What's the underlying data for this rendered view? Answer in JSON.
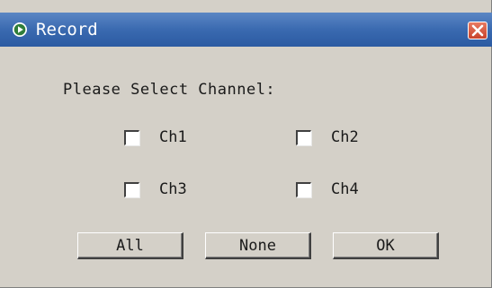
{
  "window": {
    "title": "Record",
    "colors": {
      "titlebar": "#3a6ab0",
      "body": "#d4d0c8",
      "close": "#c8432b"
    }
  },
  "prompt": "Please Select Channel:",
  "channels": [
    {
      "label": "Ch1",
      "checked": false
    },
    {
      "label": "Ch2",
      "checked": false
    },
    {
      "label": "Ch3",
      "checked": false
    },
    {
      "label": "Ch4",
      "checked": false
    }
  ],
  "buttons": {
    "all": "All",
    "none": "None",
    "ok": "OK"
  }
}
